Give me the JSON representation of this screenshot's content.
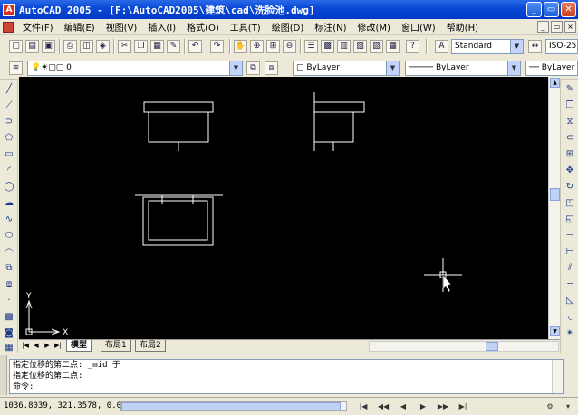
{
  "window": {
    "title": "AutoCAD 2005 - [F:\\AutoCAD2005\\建筑\\cad\\洗脸池.dwg]",
    "minimize": "_",
    "restore": "▭",
    "close": "✕"
  },
  "menu": {
    "items": [
      "文件(F)",
      "编辑(E)",
      "视图(V)",
      "插入(I)",
      "格式(O)",
      "工具(T)",
      "绘图(D)",
      "标注(N)",
      "修改(M)",
      "窗口(W)",
      "帮助(H)"
    ]
  },
  "toolbar1": {
    "text_style": "Standard",
    "dim_style": "ISO-25"
  },
  "toolbar2": {
    "layer": "0",
    "color": "ByLayer",
    "linetype": "ByLayer",
    "lineweight": "ByLayer"
  },
  "axes": {
    "y_label": "Y",
    "x_label": "X"
  },
  "tabs": {
    "items": [
      "模型",
      "布局1",
      "布局2"
    ]
  },
  "command": {
    "lines": [
      "指定位移的第二点: _mid 于",
      "指定位移的第二点:",
      "命令:"
    ]
  },
  "status": {
    "coords": "1036.8039, 321.3578, 0.00"
  },
  "colors": {
    "canvas_bg": "#000000",
    "titlebar": "#0a4ad6",
    "chrome": "#ece9d8"
  }
}
